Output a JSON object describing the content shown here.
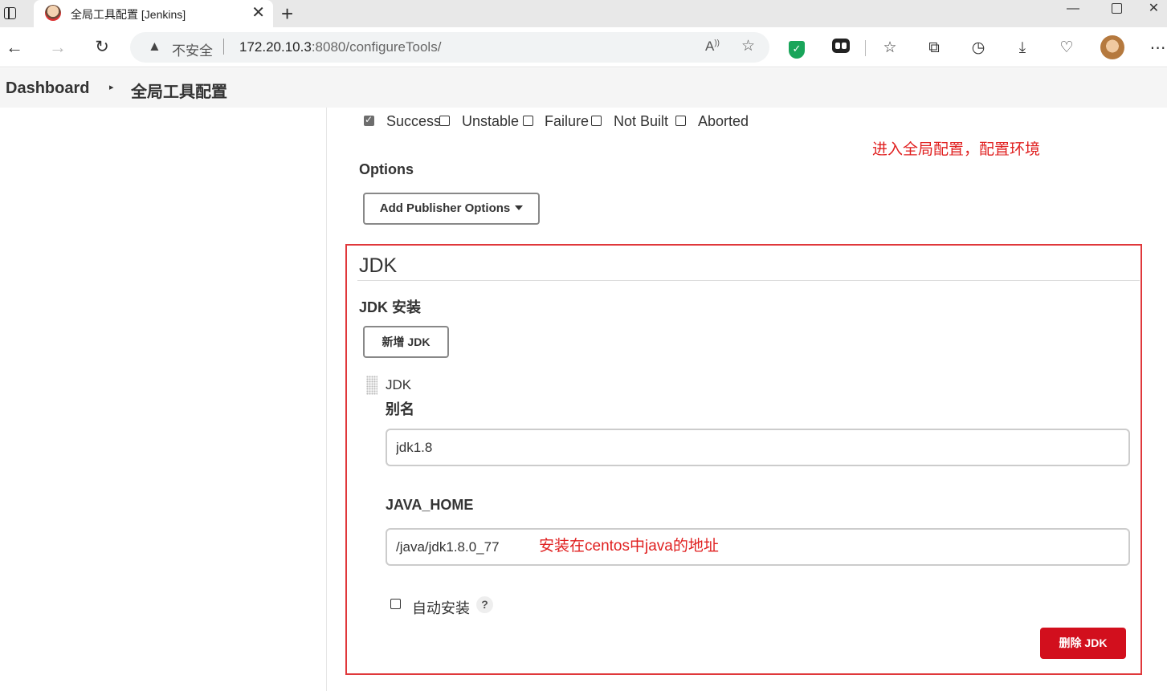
{
  "browser": {
    "tab_title": "全局工具配置 [Jenkins]",
    "tab_close": "✕",
    "new_tab": "+",
    "address": {
      "security_label": "不安全",
      "host": "172.20.10.3",
      "path": ":8080/configureTools/"
    },
    "window_controls": {
      "minimize": "—",
      "close": "✕"
    }
  },
  "breadcrumb": {
    "root": "Dashboard",
    "separator": "▸",
    "current": "全局工具配置"
  },
  "build_status": {
    "items": [
      {
        "label": "Success",
        "checked": true
      },
      {
        "label": "Unstable",
        "checked": false
      },
      {
        "label": "Failure",
        "checked": false
      },
      {
        "label": "Not Built",
        "checked": false
      },
      {
        "label": "Aborted",
        "checked": false
      }
    ]
  },
  "options": {
    "label": "Options",
    "add_publisher_button": "Add Publisher Options"
  },
  "annotations": {
    "global_config_note": "进入全局配置，配置环境",
    "java_home_note": "安装在centos中java的地址"
  },
  "jdk_section": {
    "title": "JDK",
    "install_label": "JDK 安装",
    "add_button": "新增 JDK",
    "item_label": "JDK",
    "alias_label": "别名",
    "alias_value": "jdk1.8",
    "java_home_label": "JAVA_HOME",
    "java_home_value": "/java/jdk1.8.0_77",
    "auto_install_label": "自动安装",
    "auto_install_checked": false,
    "help": "?",
    "delete_button": "删除 JDK"
  },
  "colors": {
    "annotation_red": "#e02020",
    "delete_button": "#d20f1d",
    "highlight_box": "#e0383b",
    "secure_shield": "#19a55a"
  },
  "icons": {
    "back": "arrow-left-icon",
    "forward": "arrow-right-icon",
    "reload": "reload-icon",
    "warning": "warning-triangle-icon",
    "read_aloud": "read-aloud-icon",
    "favorite": "star-add-icon",
    "favorites": "favorites-list-icon",
    "collections": "collections-icon",
    "history": "history-icon",
    "downloads": "download-icon",
    "performance": "performance-icon",
    "more": "more-menu-icon"
  }
}
